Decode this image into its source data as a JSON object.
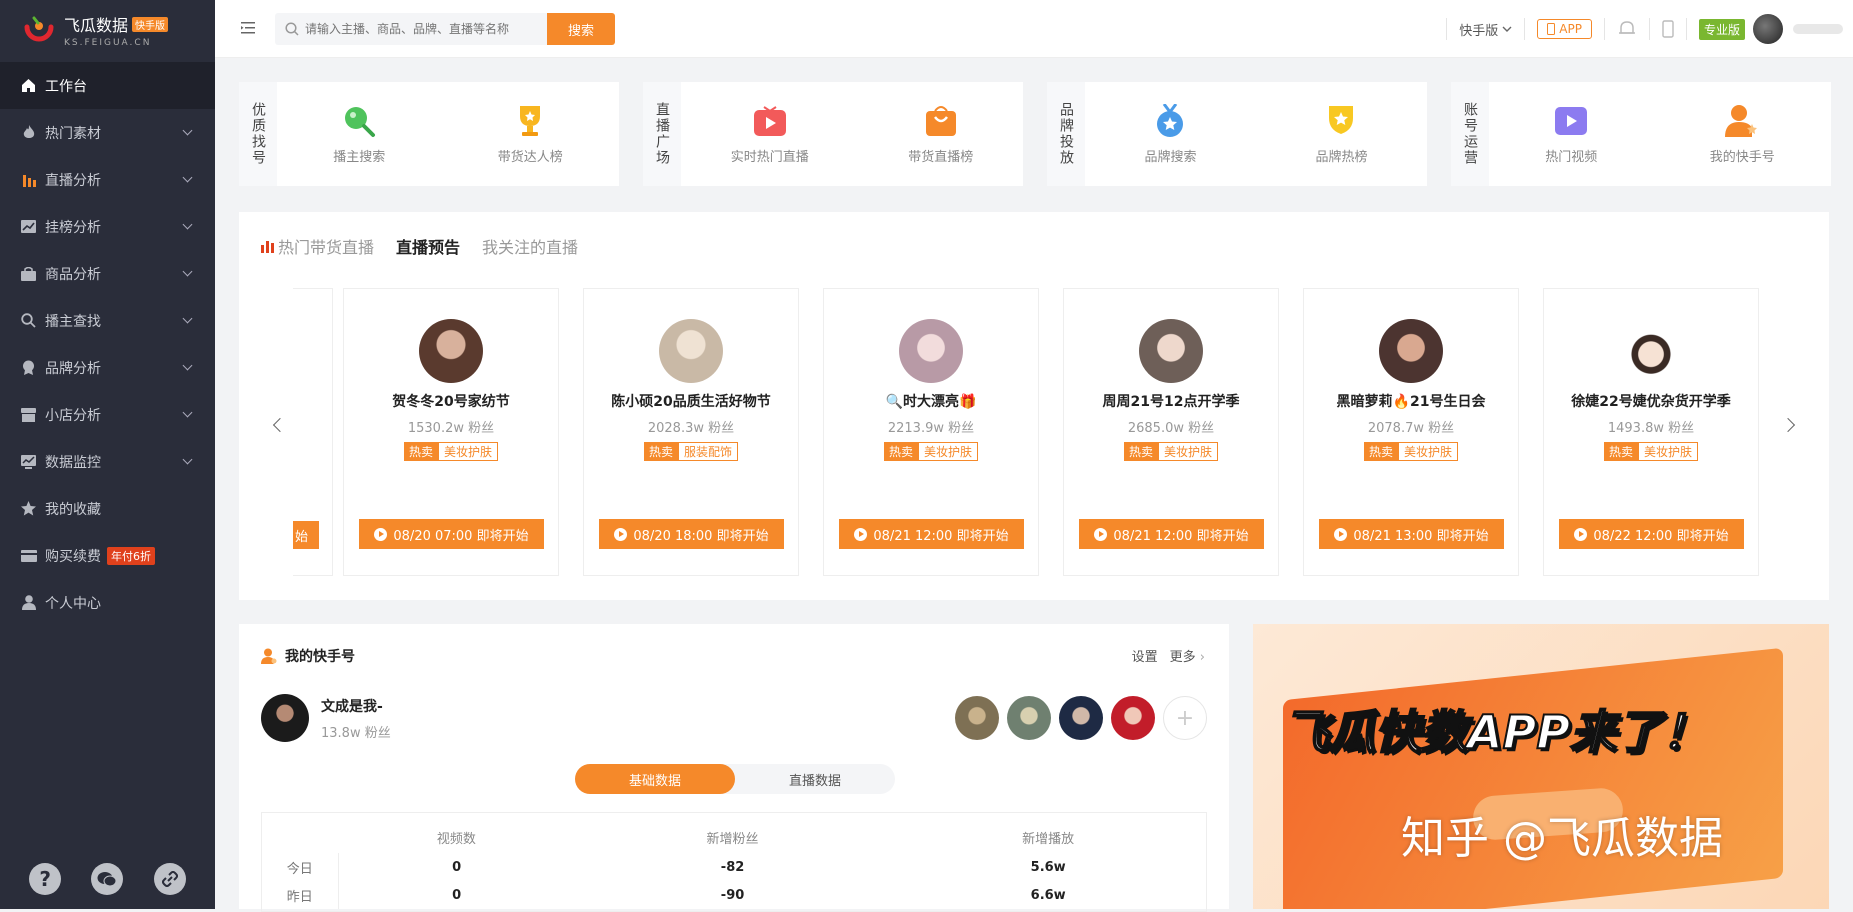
{
  "brand": {
    "name": "飞瓜数据",
    "tag": "快手版",
    "domain": "KS.FEIGUA.CN"
  },
  "sidebar": {
    "items": [
      {
        "label": "工作台",
        "icon": "home-icon",
        "active": true
      },
      {
        "label": "热门素材",
        "icon": "fire-icon",
        "chevron": true
      },
      {
        "label": "直播分析",
        "icon": "bars-icon",
        "chevron": true
      },
      {
        "label": "挂榜分析",
        "icon": "trend-icon",
        "chevron": true
      },
      {
        "label": "商品分析",
        "icon": "bag-icon",
        "chevron": true
      },
      {
        "label": "播主查找",
        "icon": "search-icon",
        "chevron": true
      },
      {
        "label": "品牌分析",
        "icon": "badge-icon",
        "chevron": true
      },
      {
        "label": "小店分析",
        "icon": "store-icon",
        "chevron": true
      },
      {
        "label": "数据监控",
        "icon": "monitor-icon",
        "chevron": true
      },
      {
        "label": "我的收藏",
        "icon": "star-icon"
      },
      {
        "label": "购买续费",
        "icon": "card-icon",
        "badge": "年付6折"
      },
      {
        "label": "个人中心",
        "icon": "user-icon"
      }
    ]
  },
  "topbar": {
    "search_placeholder": "请输入主播、商品、品牌、直播等名称",
    "search_button": "搜索",
    "version": "快手版",
    "app": "APP",
    "pro": "专业版"
  },
  "quick": [
    {
      "label": "优质找号",
      "items": [
        {
          "label": "播主搜索",
          "icon": "search-green-icon"
        },
        {
          "label": "带货达人榜",
          "icon": "trophy-icon"
        }
      ]
    },
    {
      "label": "直播广场",
      "items": [
        {
          "label": "实时热门直播",
          "icon": "tv-icon"
        },
        {
          "label": "带货直播榜",
          "icon": "shopping-bag-icon"
        }
      ]
    },
    {
      "label": "品牌投放",
      "items": [
        {
          "label": "品牌搜索",
          "icon": "medal-icon"
        },
        {
          "label": "品牌热榜",
          "icon": "shield-trophy-icon"
        }
      ]
    },
    {
      "label": "账号运营",
      "items": [
        {
          "label": "热门视频",
          "icon": "video-icon"
        },
        {
          "label": "我的快手号",
          "icon": "user-star-icon"
        }
      ]
    }
  ],
  "live": {
    "tabs": [
      "热门带货直播",
      "直播预告",
      "我关注的直播"
    ],
    "stub_button": "始",
    "cards": [
      {
        "name": "贺冬冬20号家纺节",
        "fans": "1530.2w 粉丝",
        "hot": "热卖",
        "cat": "美妆护肤",
        "time": "08/20 07:00 即将开始",
        "color": "#5a3a2e"
      },
      {
        "name": "陈小硕20品质生活好物节",
        "fans": "2028.3w 粉丝",
        "hot": "热卖",
        "cat": "服装配饰",
        "time": "08/20 18:00 即将开始",
        "color": "#c9b9a6"
      },
      {
        "name": "🔍时大漂亮🎁",
        "fans": "2213.9w 粉丝",
        "hot": "热卖",
        "cat": "美妆护肤",
        "time": "08/21 12:00 即将开始",
        "color": "#d9c2c8"
      },
      {
        "name": "周周21号12点开学季",
        "fans": "2685.0w 粉丝",
        "hot": "热卖",
        "cat": "美妆护肤",
        "time": "08/21 12:00 即将开始",
        "color": "#6e5f58"
      },
      {
        "name": "黑暗萝莉🔥21号生日会",
        "fans": "2078.7w 粉丝",
        "hot": "热卖",
        "cat": "美妆护肤",
        "time": "08/21 13:00 即将开始",
        "color": "#4c3430"
      },
      {
        "name": "徐婕22号婕优杂货开学季",
        "fans": "1493.8w 粉丝",
        "hot": "热卖",
        "cat": "美妆护肤",
        "time": "08/22 12:00 即将开始",
        "color": "#e9d9cf"
      }
    ]
  },
  "my": {
    "title": "我的快手号",
    "settings": "设置",
    "more": "更多",
    "name": "文成是我-",
    "fans": "13.8w 粉丝",
    "switch": [
      "基础数据",
      "直播数据"
    ],
    "columns": [
      "视频数",
      "新增粉丝",
      "新增播放"
    ],
    "rows": [
      {
        "label": "今日",
        "values": [
          "0",
          "-82",
          "5.6w"
        ]
      },
      {
        "label": "昨日",
        "values": [
          "0",
          "-90",
          "6.6w"
        ]
      }
    ]
  },
  "banner": {
    "title": "飞瓜快数APP来了！",
    "watermark": "知乎 @飞瓜数据"
  }
}
